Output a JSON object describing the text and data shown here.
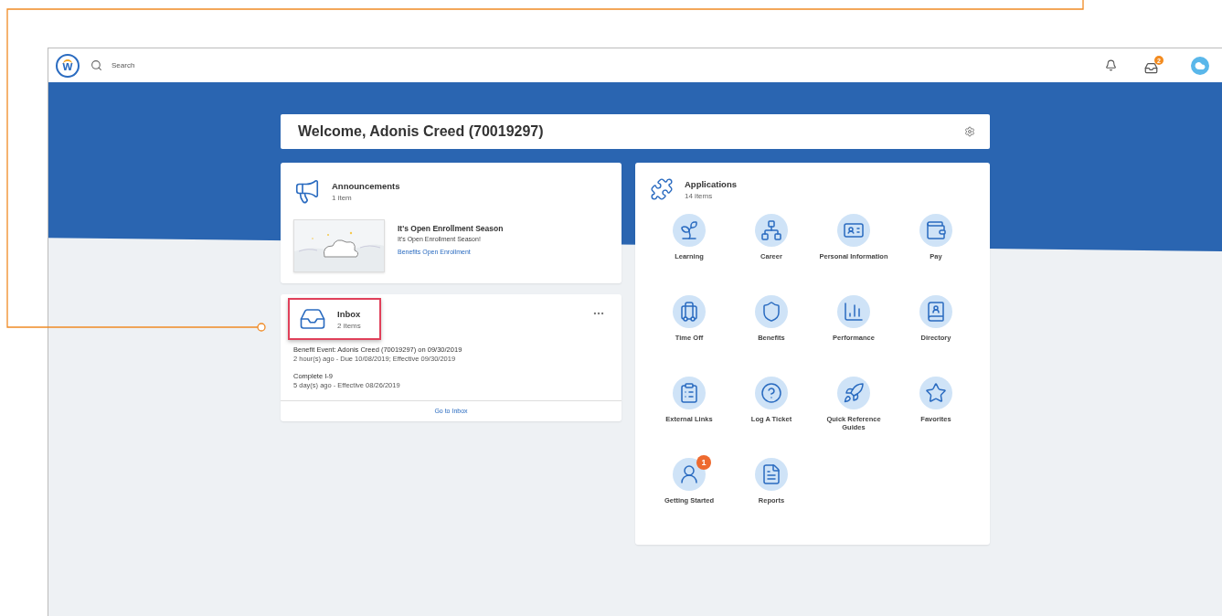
{
  "header": {
    "logo": "w",
    "search": {
      "placeholder": "Search"
    },
    "inbox_badge": "2"
  },
  "welcome": {
    "title": "Welcome, Adonis Creed (70019297)"
  },
  "announcements": {
    "title": "Announcements",
    "count": "1 item",
    "items": [
      {
        "kind": "picture",
        "title": "It's Open Enrollment Season",
        "subtitle": "It's Open Enrollment Season!",
        "link": "Benefits Open Enrollment"
      }
    ]
  },
  "inbox": {
    "title": "Inbox",
    "count": "2 items",
    "highlighted": true,
    "tasks": [
      {
        "title": "Benefit Event: Adonis Creed (70019297) on 09/30/2019",
        "meta": "2 hour(s) ago - Due 10/08/2019; Effective 09/30/2019"
      },
      {
        "title": "Complete I-9",
        "meta": "5 day(s) ago - Effective 08/26/2019"
      }
    ],
    "footer_link": "Go to Inbox"
  },
  "applications": {
    "title": "Applications",
    "count": "14 items",
    "apps": [
      {
        "label": "Learning"
      },
      {
        "label": "Career"
      },
      {
        "label": "Personal Information"
      },
      {
        "label": "Pay"
      },
      {
        "label": "Time Off"
      },
      {
        "label": "Benefits"
      },
      {
        "label": "Performance"
      },
      {
        "label": "Directory"
      },
      {
        "label": "External Links"
      },
      {
        "label": "Log A Ticket"
      },
      {
        "label": "Quick Reference Guides"
      },
      {
        "label": "Favorites"
      },
      {
        "label": "Getting Started",
        "badge": "1"
      },
      {
        "label": "Reports"
      }
    ]
  }
}
